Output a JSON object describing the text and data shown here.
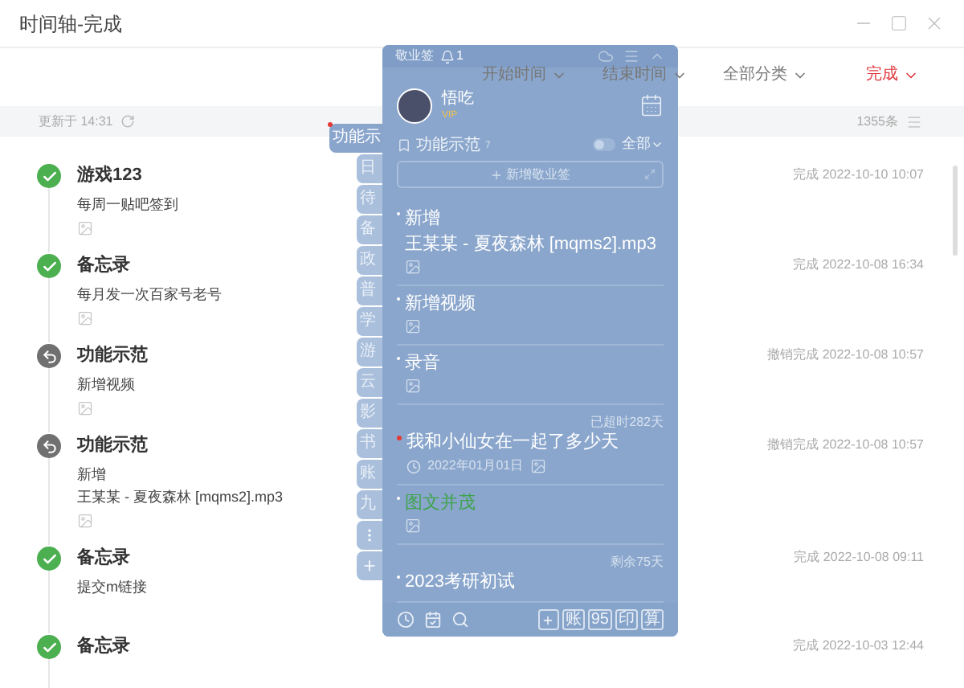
{
  "window": {
    "title": "时间轴-完成"
  },
  "filters": [
    {
      "label": "开始时间",
      "selected": false
    },
    {
      "label": "结束时间",
      "selected": false
    },
    {
      "label": "全部分类",
      "selected": false
    },
    {
      "label": "完成",
      "selected": true
    }
  ],
  "info_bar": {
    "updated": "更新于 14:31",
    "count": "1355条"
  },
  "timeline": [
    {
      "kind": "done",
      "title": "游戏123",
      "lines": [
        "每周一贴吧签到"
      ],
      "attachment": true,
      "time": "完成 2022-10-10 10:07"
    },
    {
      "kind": "done",
      "title": "备忘录",
      "lines": [
        "每月发一次百家号老号"
      ],
      "attachment": true,
      "time": "完成 2022-10-08 16:34"
    },
    {
      "kind": "undone",
      "title": "功能示范",
      "lines": [
        "新增视频"
      ],
      "attachment": true,
      "time": "撤销完成 2022-10-08 10:57"
    },
    {
      "kind": "undone",
      "title": "功能示范",
      "lines": [
        "新增",
        "王某某 - 夏夜森林 [mqms2].mp3"
      ],
      "attachment": true,
      "time": "撤销完成 2022-10-08 10:57"
    },
    {
      "kind": "done",
      "title": "备忘录",
      "lines": [
        "提交m链接"
      ],
      "attachment": false,
      "time": "完成 2022-10-08 09:11"
    },
    {
      "kind": "done",
      "title": "备忘录",
      "attachment": false,
      "time": "完成 2022-10-03 12:44"
    }
  ],
  "category_tabs": [
    {
      "label": "功能示",
      "selected": true,
      "dot": true
    },
    {
      "label": "日",
      "selected": false,
      "dot": false
    },
    {
      "label": "待",
      "selected": false,
      "dot": false
    },
    {
      "label": "备",
      "selected": false,
      "dot": false
    },
    {
      "label": "政",
      "selected": false,
      "dot": false
    },
    {
      "label": "普",
      "selected": false,
      "dot": false
    },
    {
      "label": "学",
      "selected": false,
      "dot": false
    },
    {
      "label": "游",
      "selected": false,
      "dot": false
    },
    {
      "label": "云",
      "selected": false,
      "dot": false
    },
    {
      "label": "影",
      "selected": false,
      "dot": false
    },
    {
      "label": "书",
      "selected": false,
      "dot": false
    },
    {
      "label": "账",
      "selected": false,
      "dot": false
    },
    {
      "label": "九",
      "selected": false,
      "dot": false
    }
  ],
  "widget": {
    "app_name": "敬业签",
    "notification_count": "1",
    "user": {
      "name": "悟吃",
      "badge": "VIP"
    },
    "category": {
      "name": "功能示范",
      "count": "7",
      "toggle_on": false,
      "filter": "全部"
    },
    "new_button": "新增敬业签",
    "notes": [
      {
        "title": "新增",
        "body": "王某某 - 夏夜森林 [mqms2].mp3",
        "attachment": true,
        "flagged": false
      },
      {
        "title": "新增视频",
        "attachment": true,
        "flagged": false
      },
      {
        "title": "录音",
        "attachment": true,
        "flagged": false
      },
      {
        "status": "已超时282天",
        "title": "我和小仙女在一起了多少天",
        "date": "2022年01月01日",
        "attachment": true,
        "flagged": true
      },
      {
        "title": "图文并茂",
        "color": "#3fa34d",
        "attachment": true,
        "flagged": false
      },
      {
        "status": "剩余75天",
        "title": "2023考研初试",
        "attachment": false,
        "flagged": false
      }
    ],
    "tools": [
      "账",
      "95",
      "印",
      "算"
    ]
  }
}
